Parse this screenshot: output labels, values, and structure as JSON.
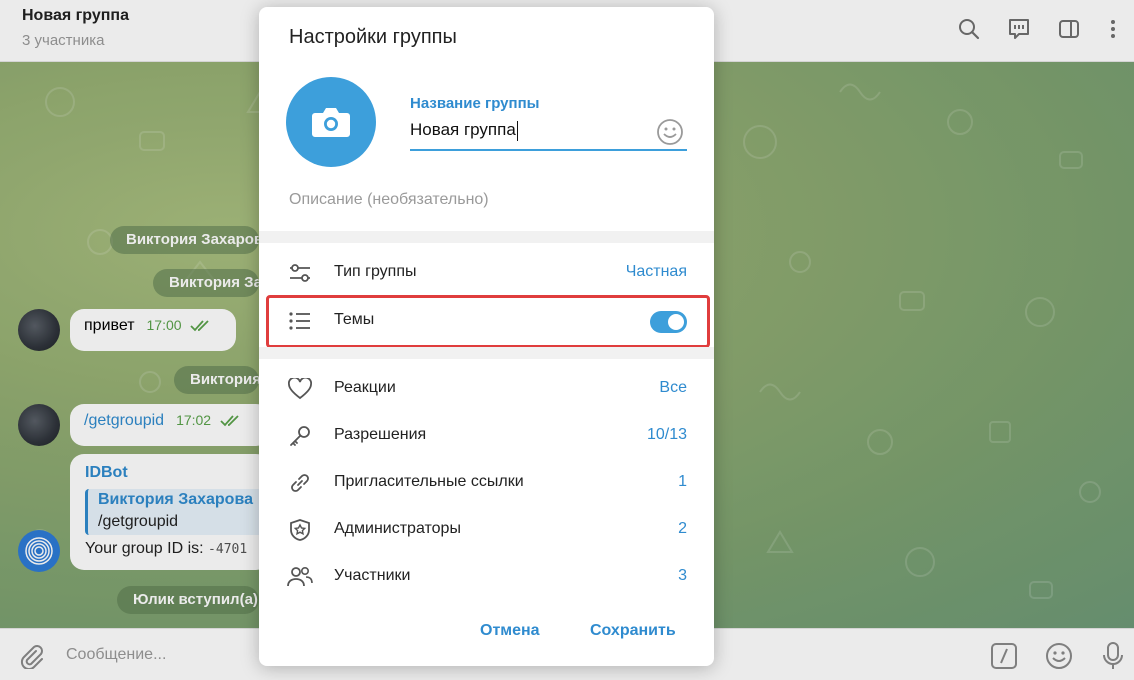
{
  "header": {
    "title": "Новая группа",
    "subtitle": "3 участника"
  },
  "chat": {
    "service_messages": [
      "Виктория Захарова создал(а) группу",
      "Виктория Захарова добавил(а)",
      "Виктория Захарова",
      "Юлик вступил(а)"
    ],
    "messages": [
      {
        "text": "привет",
        "time": "17:00"
      },
      {
        "text": "/getgroupid",
        "time": "17:02"
      }
    ],
    "bot_message": {
      "sender": "IDBot",
      "quote_author": "Виктория Захарова",
      "quote_text": "/getgroupid",
      "text_prefix": "Your group ID is:",
      "group_id": "-4701"
    }
  },
  "composer": {
    "placeholder": "Сообщение..."
  },
  "modal": {
    "title": "Настройки группы",
    "name_label": "Название группы",
    "name_value": "Новая группа",
    "description_placeholder": "Описание (необязательно)",
    "group_type": {
      "label": "Тип группы",
      "value": "Частная"
    },
    "topics": {
      "label": "Темы",
      "enabled": true
    },
    "settings": [
      {
        "label": "Реакции",
        "value": "Все",
        "icon": "heart-icon"
      },
      {
        "label": "Разрешения",
        "value": "10/13",
        "icon": "key-icon"
      },
      {
        "label": "Пригласительные ссылки",
        "value": "1",
        "icon": "link-icon"
      },
      {
        "label": "Администраторы",
        "value": "2",
        "icon": "shield-star-icon"
      },
      {
        "label": "Участники",
        "value": "3",
        "icon": "users-icon"
      }
    ],
    "cancel": "Отмена",
    "save": "Сохранить"
  },
  "colors": {
    "accent": "#3d9fdb",
    "link": "#2f8bcf",
    "highlight": "#e03d3d"
  }
}
